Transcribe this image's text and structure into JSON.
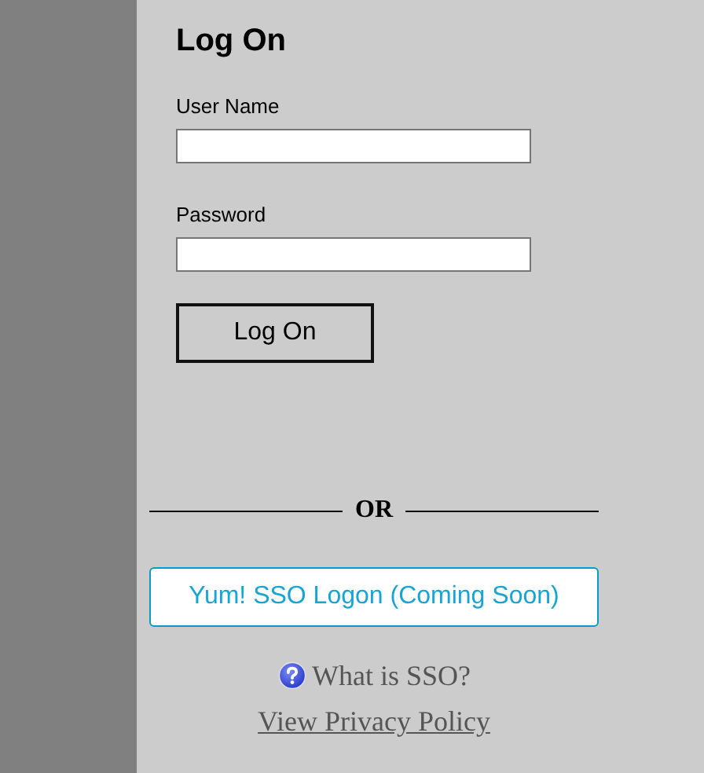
{
  "title": "Log On",
  "fields": [
    {
      "label": "User Name"
    },
    {
      "label": "Password"
    }
  ],
  "submit": "Log On",
  "separator": "OR",
  "sso_button": "Yum! SSO Logon (Coming Soon)",
  "help_link": "What is SSO?",
  "privacy_link": "View Privacy Policy"
}
